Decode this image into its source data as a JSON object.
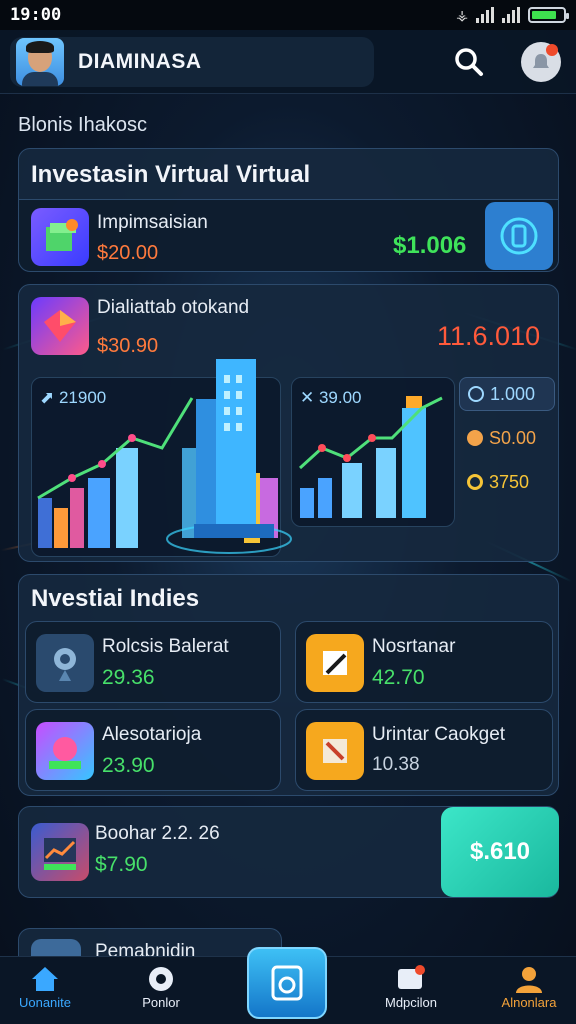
{
  "status_bar": {
    "time": "19:00"
  },
  "header": {
    "app_title": "DIAMINASA"
  },
  "section_label": "Blonis Ihakosc",
  "virtual_card": {
    "title": "Investasin Virtual Virtual",
    "row": {
      "title": "Impimsaisian",
      "price": "$20.00",
      "value": "$1.006"
    }
  },
  "chart_card": {
    "title": "Dialiattab otokand",
    "price": "$30.90",
    "value": "11.6.010",
    "left_chart_label": "21900",
    "right_chart_label": "39.00",
    "stats": [
      {
        "icon": "clock-icon",
        "value": "1.000",
        "color": "#9ed8ff"
      },
      {
        "icon": "coin-icon",
        "value": "S0.00",
        "color": "#f3a34a"
      },
      {
        "icon": "star-coin-icon",
        "value": "3750",
        "color": "#f6c437"
      }
    ]
  },
  "indies": {
    "title": "Nvestiai Indies",
    "items": [
      {
        "title": "Rolcsis Balerat",
        "value": "29.36",
        "value_color": "#47e06a"
      },
      {
        "title": "Nosrtanar",
        "value": "42.70",
        "value_color": "#47e06a"
      },
      {
        "title": "Alesotarioja",
        "value": "23.90",
        "value_color": "#47e06a"
      },
      {
        "title": "Urintar Caokget",
        "value": "10.38",
        "value_color": "#c8d3e0"
      }
    ]
  },
  "promo_row": {
    "title": "Boohar 2.2. 26",
    "value": "$7.90",
    "button_label": "$.610"
  },
  "partial_row": {
    "title": "Pemabnidin"
  },
  "nav": {
    "items": [
      {
        "label": "Uonanite",
        "color": "#3aa8ff"
      },
      {
        "label": "Ponlor",
        "color": "#e8eef8"
      },
      {
        "label": "Mdpcilon",
        "color": "#e8eef8"
      },
      {
        "label": "Alnonlara",
        "color": "#f3a23a"
      }
    ]
  }
}
